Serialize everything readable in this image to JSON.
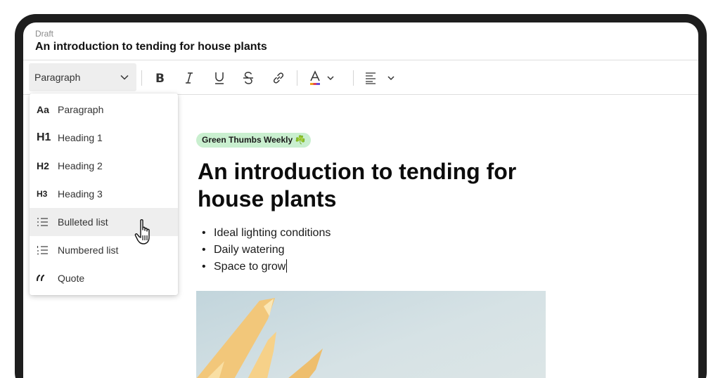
{
  "header": {
    "draft_label": "Draft",
    "title": "An introduction to tending for house plants"
  },
  "toolbar": {
    "style_select": "Paragraph",
    "buttons": [
      "bold",
      "italic",
      "underline",
      "strikethrough",
      "link",
      "text-color",
      "align"
    ]
  },
  "dropdown": {
    "items": [
      {
        "icon": "Aa",
        "label": "Paragraph"
      },
      {
        "icon": "H1",
        "label": "Heading 1"
      },
      {
        "icon": "H2",
        "label": "Heading 2"
      },
      {
        "icon": "H3",
        "label": "Heading 3"
      },
      {
        "icon": "bulleted-list-icon",
        "label": "Bulleted list"
      },
      {
        "icon": "numbered-list-icon",
        "label": "Numbered list"
      },
      {
        "icon": "quote-icon",
        "label": "Quote"
      }
    ],
    "hovered": "Bulleted list"
  },
  "content": {
    "badge": "Green Thumbs Weekly ☘️",
    "heading": "An introduction to tending for house plants",
    "bullet_marker": "•",
    "bullets": [
      "Ideal lighting conditions",
      "Daily watering",
      "Space to grow"
    ]
  },
  "colors": {
    "badge_bg": "#c9efcf",
    "hover_bg": "#eeeeee",
    "device_frame": "#1e1e1e"
  }
}
